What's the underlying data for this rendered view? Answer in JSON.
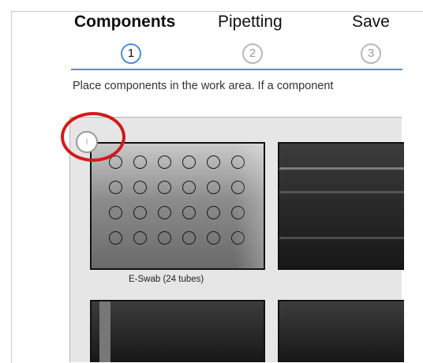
{
  "steps": [
    {
      "label": "Components",
      "number": "1",
      "state": "active"
    },
    {
      "label": "Pipetting",
      "number": "2",
      "state": "inactive"
    },
    {
      "label": "Save",
      "number": "3",
      "state": "inactive"
    }
  ],
  "instruction": "Place components in the work area. If a component",
  "work_area": {
    "slot_indicator": "I",
    "slots": [
      {
        "label": "E-Swab (24 tubes)",
        "tube_rows": 4,
        "tube_cols": 6
      }
    ]
  },
  "colors": {
    "accent": "#4a90d9",
    "highlight": "#d21a1a"
  }
}
